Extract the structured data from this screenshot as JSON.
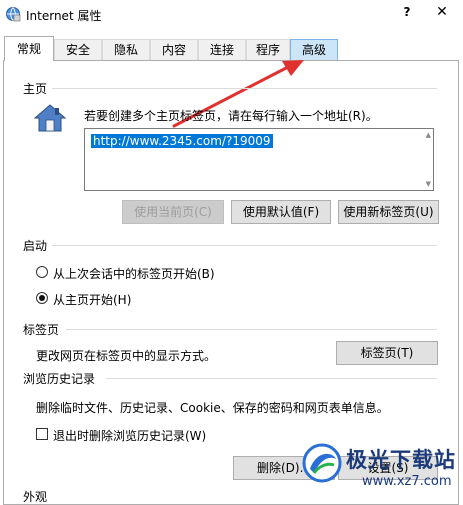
{
  "window": {
    "title": "Internet 属性",
    "help": "?",
    "close": "✕"
  },
  "tabs": [
    {
      "label": "常规",
      "active": true
    },
    {
      "label": "安全"
    },
    {
      "label": "隐私"
    },
    {
      "label": "内容"
    },
    {
      "label": "连接"
    },
    {
      "label": "程序"
    },
    {
      "label": "高级",
      "highlighted": true
    }
  ],
  "homepage": {
    "section_label": "主页",
    "description": "若要创建多个主页标签页，请在每行输入一个地址(R)。",
    "url_value": "http://www.2345.com/?19009",
    "btn_current": "使用当前页(C)",
    "btn_default": "使用默认值(F)",
    "btn_newtab": "使用新标签页(U)"
  },
  "startup": {
    "section_label": "启动",
    "option_last_session": "从上次会话中的标签页开始(B)",
    "option_homepage": "从主页开始(H)",
    "selected": "option_homepage"
  },
  "tabs_section": {
    "section_label": "标签页",
    "description": "更改网页在标签页中的显示方式。",
    "btn_tabs": "标签页(T)"
  },
  "history": {
    "section_label": "浏览历史记录",
    "description": "删除临时文件、历史记录、Cookie、保存的密码和网页表单信息。",
    "checkbox_delete_on_exit": "退出时删除浏览历史记录(W)",
    "checkbox_checked": false,
    "btn_delete": "删除(D)...",
    "btn_settings": "设置(S)"
  },
  "appearance": {
    "section_label": "外观"
  },
  "watermark": {
    "title": "极光下载站",
    "url": "www.xz7.com"
  },
  "colors": {
    "selection": "#0078d7",
    "arrow": "#e0312f",
    "highlight_tab": "#cde6f7"
  }
}
